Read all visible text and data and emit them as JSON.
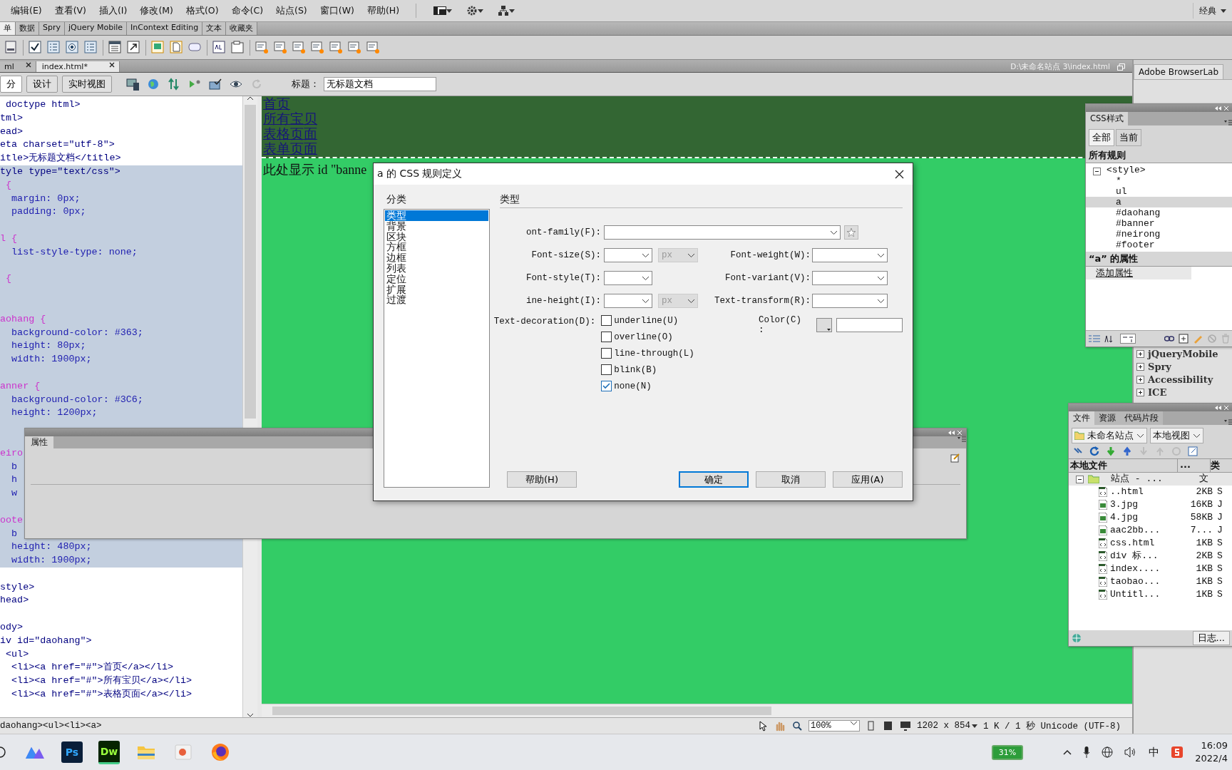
{
  "menu_bar": {
    "items": [
      "编辑(E)",
      "查看(V)",
      "插入(I)",
      "修改(M)",
      "格式(O)",
      "命令(C)",
      "站点(S)",
      "窗口(W)",
      "帮助(H)"
    ],
    "workspace": "经典"
  },
  "insert_bar": {
    "tabs": [
      {
        "label": "单",
        "selected": true
      },
      {
        "label": "数据",
        "selected": false
      },
      {
        "label": "Spry",
        "selected": false
      },
      {
        "label": "jQuery Mobile",
        "selected": false
      },
      {
        "label": "InContext Editing",
        "selected": false
      },
      {
        "label": "文本",
        "selected": false
      },
      {
        "label": "收藏夹",
        "selected": false
      }
    ]
  },
  "document_tabs": [
    {
      "label": "ml",
      "selected": false
    },
    {
      "label": "index.html*",
      "selected": true
    }
  ],
  "document_path": "D:\\未命名站点 3\\index.html",
  "view_buttons": [
    {
      "label": "分",
      "selected": true
    },
    {
      "label": "设计",
      "selected": false
    },
    {
      "label": "实时视图",
      "selected": false
    }
  ],
  "title_field": {
    "label": "标题：",
    "value": "无标题文档"
  },
  "code_lines": [
    {
      "text": " doctype html>",
      "kind": "tag",
      "selected": false
    },
    {
      "text": "tml>",
      "kind": "tag",
      "selected": false
    },
    {
      "text": "ead>",
      "kind": "tag",
      "selected": false
    },
    {
      "text": "eta charset=\"utf-8\">",
      "kind": "tag",
      "selected": false
    },
    {
      "text": "itle>无标题文档</title>",
      "kind": "tag",
      "selected": false
    },
    {
      "text": "tyle type=\"text/css\">",
      "kind": "tag",
      "selected": true
    },
    {
      "text": " {",
      "kind": "selector",
      "selected": true
    },
    {
      "text": "  margin: 0px;",
      "kind": "declaration",
      "selected": true
    },
    {
      "text": "  padding: 0px;",
      "kind": "declaration",
      "selected": true
    },
    {
      "kind": "blank",
      "selected": true
    },
    {
      "text": "l {",
      "kind": "selector",
      "selected": true
    },
    {
      "text": "  list-style-type: none;",
      "kind": "declaration",
      "selected": true
    },
    {
      "kind": "blank",
      "selected": true
    },
    {
      "text": " {",
      "kind": "selector",
      "selected": true
    },
    {
      "kind": "blank",
      "selected": true
    },
    {
      "kind": "blank",
      "selected": true
    },
    {
      "text": "aohang {",
      "kind": "selector",
      "selected": true
    },
    {
      "text": "  background-color: #363;",
      "kind": "declaration",
      "selected": true
    },
    {
      "text": "  height: 80px;",
      "kind": "declaration",
      "selected": true
    },
    {
      "text": "  width: 1900px;",
      "kind": "declaration",
      "selected": true
    },
    {
      "kind": "blank",
      "selected": true
    },
    {
      "text": "anner {",
      "kind": "selector",
      "selected": true
    },
    {
      "text": "  background-color: #3C6;",
      "kind": "declaration",
      "selected": true
    },
    {
      "text": "  height: 1200px;",
      "kind": "declaration",
      "selected": true
    },
    {
      "kind": "blank",
      "selected": true
    },
    {
      "kind": "blank",
      "selected": true
    },
    {
      "text": "eiro",
      "kind": "selector",
      "selected": true
    },
    {
      "text": "  b",
      "kind": "declaration",
      "selected": true
    },
    {
      "text": "  h",
      "kind": "declaration",
      "selected": true
    },
    {
      "text": "  w",
      "kind": "declaration",
      "selected": true
    },
    {
      "kind": "blank",
      "selected": true
    },
    {
      "text": "oote",
      "kind": "selector",
      "selected": true
    },
    {
      "text": "  b",
      "kind": "declaration",
      "selected": true
    },
    {
      "text": "  height: 480px;",
      "kind": "declaration",
      "selected": true
    },
    {
      "text": "  width: 1900px;",
      "kind": "declaration",
      "selected": true
    },
    {
      "kind": "blank",
      "selected": false
    },
    {
      "text": "style>",
      "kind": "tag",
      "selected": false
    },
    {
      "text": "head>",
      "kind": "tag",
      "selected": false
    },
    {
      "kind": "blank",
      "selected": false
    },
    {
      "text": "ody>",
      "kind": "tag",
      "selected": false
    },
    {
      "text": "iv id=\"daohang\">",
      "kind": "tag",
      "selected": false
    },
    {
      "text": " <ul>",
      "kind": "tag",
      "selected": false
    },
    {
      "text": "  <li><a href=\"#\">首页</a></li>",
      "kind": "tag",
      "selected": false
    },
    {
      "text": "  <li><a href=\"#\">所有宝贝</a></li>",
      "kind": "tag",
      "selected": false
    },
    {
      "text": "  <li><a href=\"#\">表格页面</a></li>",
      "kind": "tag",
      "selected": false
    }
  ],
  "design_view": {
    "nav_links": [
      "首页",
      "所有宝贝",
      "表格页面",
      "表单页面"
    ],
    "banner_text": "此处显示 id \"banne"
  },
  "status_bar": {
    "tag_path": "daohang><ul><li><a>",
    "zoom": "100%",
    "size": "1202 x 854",
    "info": "1 K / 1 秒 Unicode (UTF-8)"
  },
  "right_panel": {
    "tab": "Adobe BrowserLab",
    "groups": [
      {
        "label": "jQueryMobile",
        "expanded": false
      },
      {
        "label": "Spry",
        "expanded": false
      },
      {
        "label": "Accessibility",
        "expanded": false
      },
      {
        "label": "ICE",
        "expanded": false
      }
    ]
  },
  "properties_panel": {
    "tab": "属性"
  },
  "css_panel": {
    "tab": "CSS样式",
    "modes": [
      {
        "label": "全部",
        "selected": true
      },
      {
        "label": "当前",
        "selected": false
      }
    ],
    "rules_heading": "所有规则",
    "tree": {
      "label": "<style>",
      "expanded": true,
      "children": [
        {
          "label": "*",
          "selected": false
        },
        {
          "label": "ul",
          "selected": false
        },
        {
          "label": "a",
          "selected": true
        },
        {
          "label": "#daohang",
          "selected": false
        },
        {
          "label": "#banner",
          "selected": false
        },
        {
          "label": "#neirong",
          "selected": false
        },
        {
          "label": "#footer",
          "selected": false
        }
      ]
    },
    "properties_heading": "“a” 的属性",
    "add_property": "添加属性"
  },
  "files_panel": {
    "tabs": [
      {
        "label": "文件",
        "selected": true
      },
      {
        "label": "资源",
        "selected": false
      },
      {
        "label": "代码片段",
        "selected": false
      }
    ],
    "site": "未命名站点",
    "view": "本地视图",
    "columns": [
      "本地文件",
      "...",
      "类"
    ],
    "root": {
      "name": "站点 - ...",
      "type": "文",
      "expanded": true
    },
    "files": [
      {
        "name": "..html",
        "size": "2KB",
        "type": "S",
        "kind": "page"
      },
      {
        "name": "3.jpg",
        "size": "16KB",
        "type": "J",
        "kind": "image"
      },
      {
        "name": "4.jpg",
        "size": "58KB",
        "type": "J",
        "kind": "image"
      },
      {
        "name": "aac2bb...",
        "size": "7...",
        "type": "J",
        "kind": "image"
      },
      {
        "name": "css.html",
        "size": "1KB",
        "type": "S",
        "kind": "page"
      },
      {
        "name": "div 标...",
        "size": "2KB",
        "type": "S",
        "kind": "page"
      },
      {
        "name": "index....",
        "size": "1KB",
        "type": "S",
        "kind": "page"
      },
      {
        "name": "taobao...",
        "size": "1KB",
        "type": "S",
        "kind": "page"
      },
      {
        "name": "Untitl...",
        "size": "1KB",
        "type": "S",
        "kind": "page"
      }
    ],
    "log_button": "日志..."
  },
  "dialog": {
    "title": "a 的 CSS 规则定义",
    "category_label": "分类",
    "categories": [
      {
        "label": "类型",
        "selected": true
      },
      {
        "label": "背景",
        "selected": false
      },
      {
        "label": "区块",
        "selected": false
      },
      {
        "label": "方框",
        "selected": false
      },
      {
        "label": "边框",
        "selected": false
      },
      {
        "label": "列表",
        "selected": false
      },
      {
        "label": "定位",
        "selected": false
      },
      {
        "label": "扩展",
        "selected": false
      },
      {
        "label": "过渡",
        "selected": false
      }
    ],
    "section": "类型",
    "font_family": "ont-family(F):",
    "fields": [
      {
        "label": "Font-size(S):",
        "unit": "px",
        "label2": "Font-weight(W):"
      },
      {
        "label": "Font-style(T):",
        "label2": "Font-variant(V):"
      },
      {
        "label": "ine-height(I):",
        "unit": "px",
        "label2": "Text-transform(R):"
      }
    ],
    "decoration_label": "Text-decoration(D):",
    "decorations": [
      {
        "label": "underline(U)",
        "checked": false
      },
      {
        "label": "overline(O)",
        "checked": false
      },
      {
        "label": "line-through(L)",
        "checked": false
      },
      {
        "label": "blink(B)",
        "checked": false
      },
      {
        "label": "none(N)",
        "checked": true
      }
    ],
    "color_label": "Color(C)  :",
    "buttons": [
      {
        "label": "帮助(H)",
        "default": false
      },
      {
        "label": "确定",
        "default": true
      },
      {
        "label": "取消",
        "default": false
      },
      {
        "label": "应用(A)",
        "default": false
      }
    ]
  },
  "taskbar": {
    "apps": [
      {
        "kind": "mountain"
      },
      {
        "kind": "ps",
        "label": "Ps"
      },
      {
        "kind": "dw",
        "label": "Dw"
      },
      {
        "kind": "folder"
      },
      {
        "kind": "slides"
      },
      {
        "kind": "browser"
      }
    ],
    "battery": "31%",
    "ime": "中",
    "time": "16:09",
    "date": "2022/4"
  }
}
